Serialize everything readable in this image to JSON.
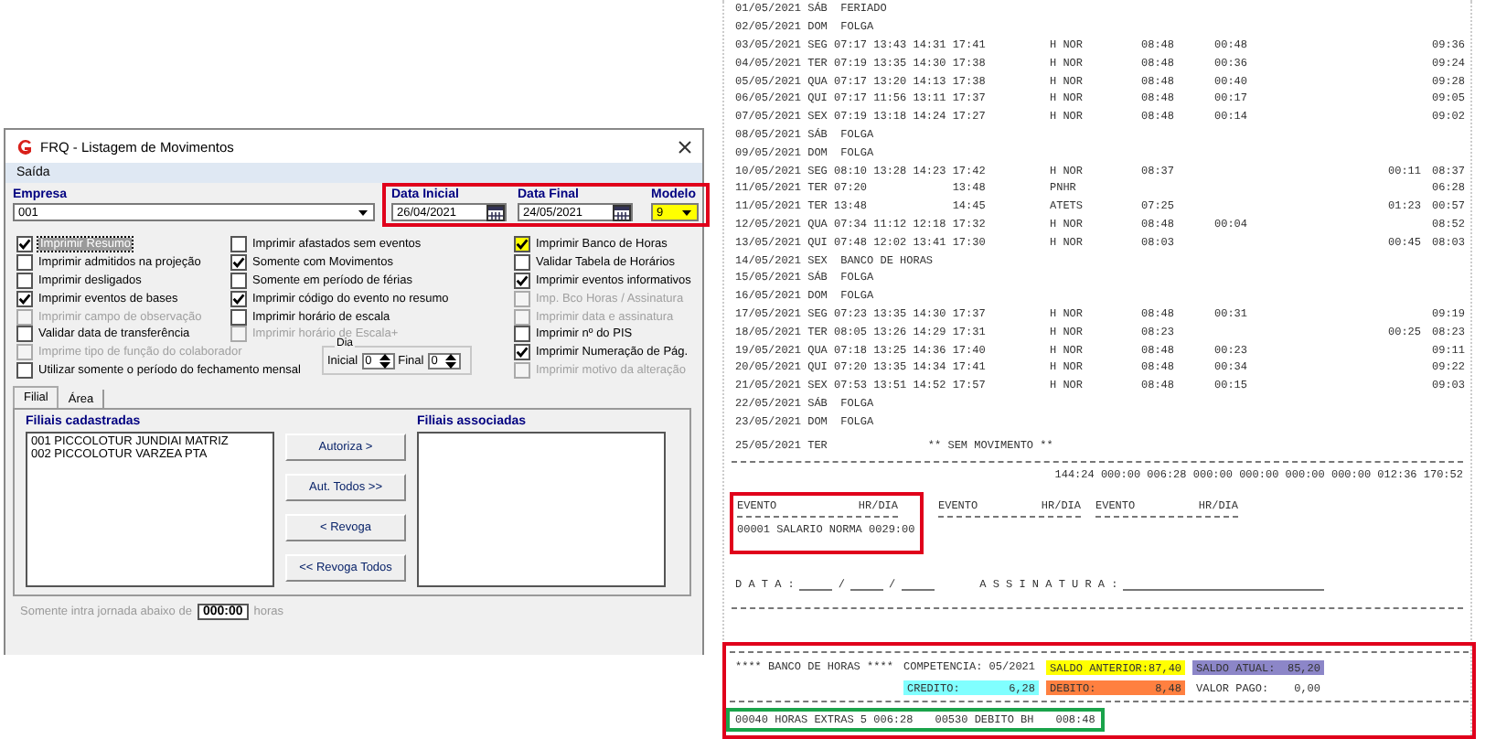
{
  "window": {
    "title": "FRQ - Listagem de Movimentos"
  },
  "menu": [
    "Saída"
  ],
  "empresa": {
    "label": "Empresa",
    "value": "001"
  },
  "dates": {
    "start_label": "Data Inicial",
    "start": "26/04/2021",
    "end_label": "Data Final",
    "end": "24/05/2021",
    "model_label": "Modelo",
    "model": {
      "value": "9",
      "highlighted": true
    }
  },
  "options": [
    [
      {
        "label": "Imprimir Resumo",
        "checked": true,
        "disabled": false,
        "focused": true
      },
      {
        "label": "Imprimir admitidos na projeção",
        "checked": false,
        "disabled": false,
        "focused": false
      },
      {
        "label": "Imprimir desligados",
        "checked": false,
        "disabled": false,
        "focused": false
      },
      {
        "label": "Imprimir eventos de bases",
        "checked": true,
        "disabled": false,
        "focused": false
      },
      {
        "label": "Imprimir campo de observação",
        "checked": false,
        "disabled": true,
        "focused": false
      },
      {
        "label": "Validar data de transferência",
        "checked": false,
        "disabled": false,
        "focused": false
      },
      {
        "label": "Imprime tipo de função do colaborador",
        "checked": false,
        "disabled": true,
        "focused": false
      },
      {
        "label": "Utilizar somente o período do fechamento mensal",
        "checked": false,
        "disabled": false,
        "focused": false
      }
    ],
    [
      {
        "label": "Imprimir afastados sem eventos",
        "checked": false,
        "disabled": false,
        "focused": false
      },
      {
        "label": "Somente com Movimentos",
        "checked": true,
        "disabled": false,
        "focused": false
      },
      {
        "label": "Somente em período de férias",
        "checked": false,
        "disabled": false,
        "focused": false
      },
      {
        "label": "Imprimir código do evento no resumo",
        "checked": true,
        "disabled": false,
        "focused": false
      },
      {
        "label": "Imprimir horário de escala",
        "checked": false,
        "disabled": false,
        "focused": false
      },
      {
        "label": "Imprimir horário de Escala+",
        "checked": false,
        "disabled": true,
        "focused": false
      }
    ],
    [
      {
        "label": "Imprimir Banco de Horas",
        "checked": true,
        "disabled": false,
        "focused": false,
        "color": "#ffff00"
      },
      {
        "label": "Validar Tabela de Horários",
        "checked": false,
        "disabled": false,
        "focused": false
      },
      {
        "label": "Imprimir eventos informativos",
        "checked": true,
        "disabled": false,
        "focused": false
      },
      {
        "label": "Imp. Bco Horas / Assinatura",
        "checked": false,
        "disabled": true,
        "focused": false
      },
      {
        "label": "Imprimir data e assinatura",
        "checked": false,
        "disabled": true,
        "focused": false
      },
      {
        "label": "Imprimir nº do PIS",
        "checked": false,
        "disabled": false,
        "focused": false
      },
      {
        "label": "Imprimir Numeração de Pág.",
        "checked": true,
        "disabled": false,
        "focused": false
      },
      {
        "label": "Imprimir motivo da alteração",
        "checked": false,
        "disabled": true,
        "focused": false
      }
    ]
  ],
  "day_range": {
    "title": "Dia",
    "start_label": "Inicial",
    "start": "0",
    "end_label": "Final",
    "end": "0"
  },
  "tabs": [
    {
      "label": "Filial",
      "selected": true
    },
    {
      "label": "Área",
      "selected": false
    }
  ],
  "available": {
    "label": "Filiais cadastradas",
    "items": [
      "001 PICCOLOTUR JUNDIAI MATRIZ",
      "002 PICCOLOTUR VARZEA PTA"
    ]
  },
  "actions": [
    "Autoriza >",
    "Aut. Todos >>",
    "< Revoga",
    "<< Revoga Todos"
  ],
  "associated": {
    "label": "Filiais associadas"
  },
  "intra": {
    "before": "Somente intra jornada abaixo de",
    "value": "000:00",
    "after": "horas",
    "disabled": true
  },
  "report": {
    "rows": [
      {
        "text": "01/05/2021 SÁB  FERIADO"
      },
      {
        "text": "02/05/2021 DOM  FOLGA"
      },
      {
        "text": "03/05/2021 SEG 07:17 13:43 14:31 17:41",
        "code": "H NOR",
        "column_3": "08:48",
        "column_4": "00:48",
        "column_6": "09:36"
      },
      {
        "text": "04/05/2021 TER 07:19 13:35 14:30 17:38",
        "code": "H NOR",
        "column_3": "08:48",
        "column_4": "00:36",
        "column_6": "09:24"
      },
      {
        "text": "05/05/2021 QUA 07:17 13:20 14:13 17:38",
        "code": "H NOR",
        "column_3": "08:48",
        "column_4": "00:40",
        "column_6": "09:28"
      },
      {
        "text": "06/05/2021 QUI 07:17 11:56 13:11 17:37",
        "code": "H NOR",
        "column_3": "08:48",
        "column_4": "00:17",
        "column_6": "09:05"
      },
      {
        "text": "07/05/2021 SEX 07:19 13:18 14:24 17:27",
        "code": "H NOR",
        "column_3": "08:48",
        "column_4": "00:14",
        "column_6": "09:02"
      },
      {
        "text": "08/05/2021 SÁB  FOLGA"
      },
      {
        "text": "09/05/2021 DOM  FOLGA"
      },
      {
        "text": "10/05/2021 SEG 08:10 13:28 14:23 17:42",
        "code": "H NOR",
        "column_3": "08:37",
        "column_5": "00:11",
        "column_6": "08:37"
      },
      {
        "text": "11/05/2021 TER 07:20             13:48",
        "code": "PNHR",
        "column_6": "06:28"
      },
      {
        "text": "11/05/2021 TER 13:48             14:45",
        "code": "ATETS",
        "column_3": "07:25",
        "column_5": "01:23",
        "column_6": "00:57"
      },
      {
        "text": "12/05/2021 QUA 07:34 11:12 12:18 17:32",
        "code": "H NOR",
        "column_3": "08:48",
        "column_4": "00:04",
        "column_6": "08:52"
      },
      {
        "text": "13/05/2021 QUI 07:48 12:02 13:41 17:30",
        "code": "H NOR",
        "column_3": "08:03",
        "column_5": "00:45",
        "column_6": "08:03"
      },
      {
        "text": "14/05/2021 SEX  BANCO DE HORAS"
      },
      {
        "text": "15/05/2021 SÁB  FOLGA"
      },
      {
        "text": "16/05/2021 DOM  FOLGA"
      },
      {
        "text": "17/05/2021 SEG 07:23 13:35 14:30 17:37",
        "code": "H NOR",
        "column_3": "08:48",
        "column_4": "00:31",
        "column_6": "09:19"
      },
      {
        "text": "18/05/2021 TER 08:05 13:26 14:29 17:31",
        "code": "H NOR",
        "column_3": "08:23",
        "column_5": "00:25",
        "column_6": "08:23"
      },
      {
        "text": "19/05/2021 QUA 07:18 13:25 14:36 17:40",
        "code": "H NOR",
        "column_3": "08:48",
        "column_4": "00:23",
        "column_6": "09:11"
      },
      {
        "text": "20/05/2021 QUI 07:20 13:35 14:34 17:41",
        "code": "H NOR",
        "column_3": "08:48",
        "column_4": "00:34",
        "column_6": "09:22"
      },
      {
        "text": "21/05/2021 SEX 07:53 13:51 14:52 17:57",
        "code": "H NOR",
        "column_3": "08:48",
        "column_4": "00:15",
        "column_6": "09:03"
      },
      {
        "text": "22/05/2021 SÁB  FOLGA"
      },
      {
        "text": "23/05/2021 DOM  FOLGA"
      }
    ],
    "last_row": {
      "text": "25/05/2021 TER",
      "note": "** SEM MOVIMENTO **"
    },
    "totals": "144:24 000:00 006:28 000:00 000:00 000:00 000:00 012:36 170:52",
    "event_columns": [
      {
        "name": "EVENTO",
        "hours": "HR/DIA"
      },
      {
        "name": "EVENTO",
        "hours": "HR/DIA"
      },
      {
        "name": "EVENTO",
        "hours": "HR/DIA"
      }
    ],
    "event_entry": "00001 SALARIO NORMA 0029:00",
    "date_label": "D A T A :",
    "date_separators": [
      "/",
      "/"
    ],
    "signature_label": "A S S I N A T U R A :",
    "bank": {
      "title": "**** BANCO DE HORAS ****",
      "competence": "COMPETENCIA: 05/2021",
      "cells": [
        {
          "label": "SALDO ANTERIOR:",
          "value": "87,40",
          "color": "#ffff00"
        },
        {
          "label": "SALDO ATUAL:",
          "value": "85,20",
          "color": "#8c86c8"
        },
        {
          "label": "CREDITO:",
          "value": "6,28",
          "color": "#80ffff"
        },
        {
          "label": "DEBITO:",
          "value": "8,48",
          "color": "#ff8040"
        },
        {
          "label": "VALOR PAGO:",
          "value": "0,00"
        }
      ]
    },
    "bank_entries": [
      "00040 HORAS EXTRAS 5 006:28",
      "00530 DEBITO BH",
      "008:48"
    ]
  }
}
